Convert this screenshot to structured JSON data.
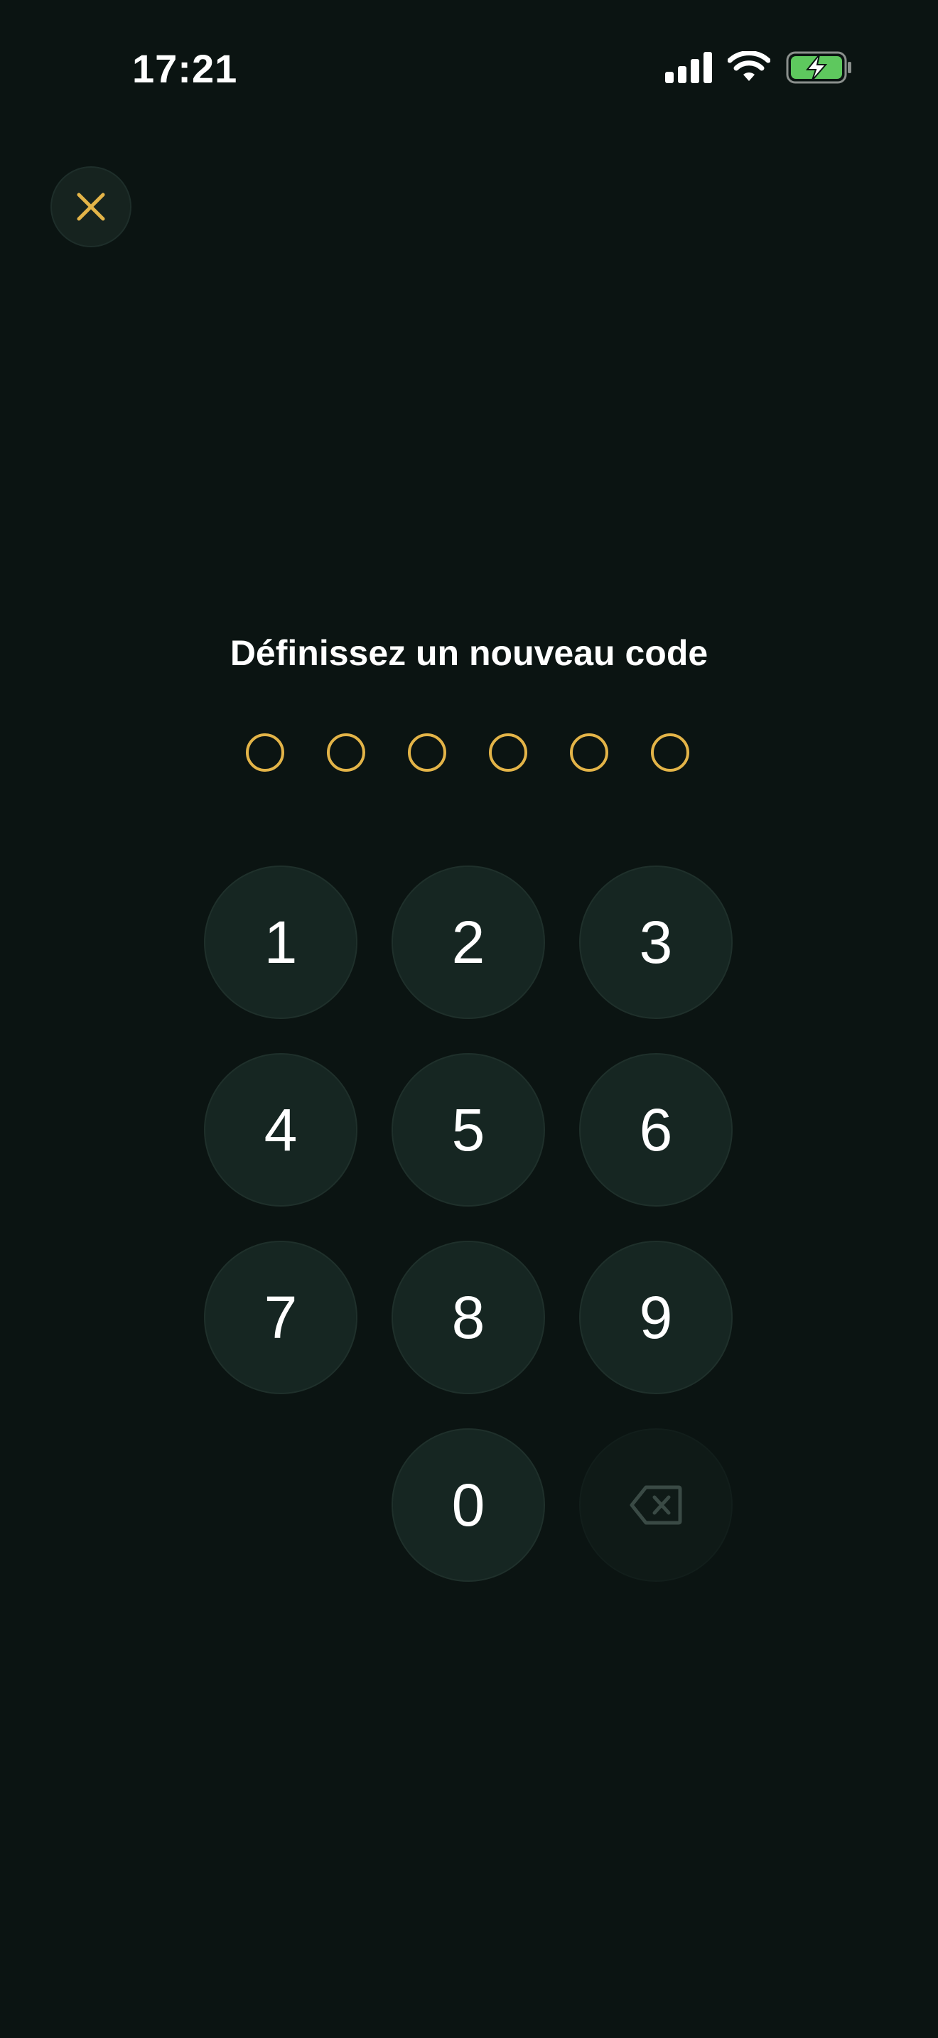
{
  "status_bar": {
    "time": "17:21",
    "battery_color": "#5ec85e"
  },
  "header": {
    "close_icon": "close-icon",
    "accent_color": "#e3b448"
  },
  "prompt": {
    "title": "Définissez un nouveau code"
  },
  "pin": {
    "length": 6,
    "filled": 0
  },
  "keypad": {
    "keys": [
      "1",
      "2",
      "3",
      "4",
      "5",
      "6",
      "7",
      "8",
      "9",
      "0"
    ],
    "delete_icon": "backspace-icon",
    "delete_enabled": false
  }
}
